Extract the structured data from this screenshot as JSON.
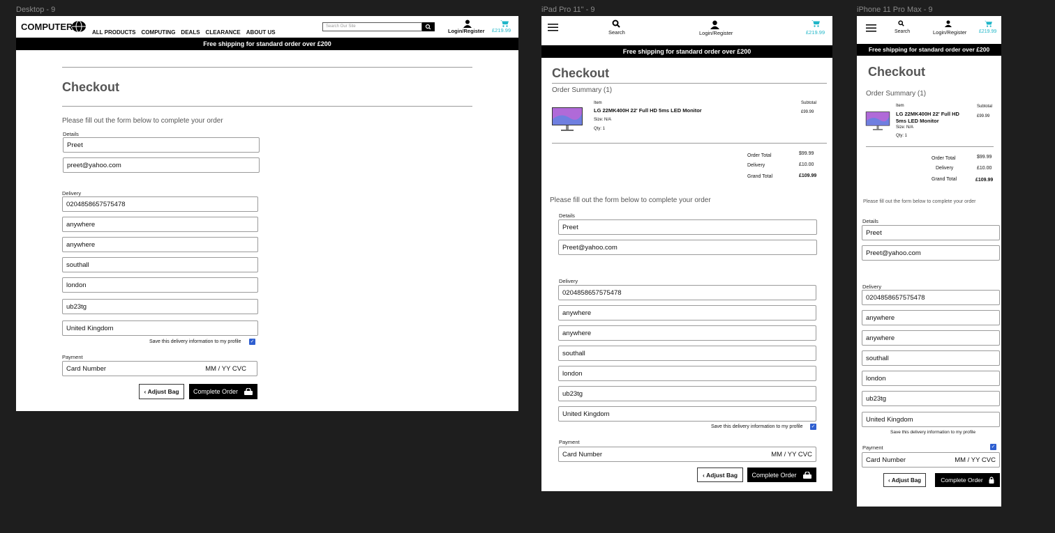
{
  "frames": {
    "desktop": "Desktop - 9",
    "ipad": "iPad Pro 11\" - 9",
    "iphone": "iPhone 11 Pro Max - 9"
  },
  "brand": "COMPUTER",
  "nav": [
    "ALL PRODUCTS",
    "COMPUTING",
    "DEALS",
    "CLEARANCE",
    "ABOUT US"
  ],
  "search": {
    "placeholder": "Search Our Site",
    "label": "Search"
  },
  "account": "Login/Register",
  "cart_total": "£219.99",
  "banner": "Free shipping for standard order over £200",
  "checkout_title": "Checkout",
  "order_summary": "Order Summary (1)",
  "item": {
    "header": "Item",
    "subtotal_header": "Subtotal",
    "name": "LG 22MK400H 22' Full HD 5ms LED Monitor",
    "name_line1": "LG 22MK400H 22' Full HD",
    "name_line2": "5ms LED Monitor",
    "size": "Size: N/A",
    "qty": "Qty: 1",
    "price": "£99.99"
  },
  "totals": {
    "order_total_label": "Order Total",
    "order_total": "$99.99",
    "delivery_label": "Delivery",
    "delivery": "£10.00",
    "grand_total_label": "Grand Total",
    "grand_total": "£109.99"
  },
  "intro": "Please fill out the form below to complete your order",
  "details_label": "Details",
  "details": {
    "name": "Preet",
    "email_desktop": "preet@yahoo.com",
    "email_mobile": "Preet@yahoo.com"
  },
  "delivery_label": "Delivery",
  "delivery_fields": [
    "0204858657575478",
    "anywhere",
    "anywhere",
    "southall",
    "london",
    "ub23tg",
    "United Kingdom"
  ],
  "save_info": "Save this delivery information to my profile",
  "payment_label": "Payment",
  "payment": {
    "card": "Card Number",
    "exp": "MM / YY CVC"
  },
  "buttons": {
    "adjust": "Adjust Bag",
    "complete": "Complete Order"
  },
  "icons": {
    "menu": "menu-icon",
    "search": "search-icon",
    "user": "user-icon",
    "cart": "cart-icon",
    "lock": "lock-icon",
    "globe": "globe-icon"
  },
  "colors": {
    "accent": "#1fb6c8",
    "checkbox": "#2f5fd0",
    "banner": "#000000"
  }
}
